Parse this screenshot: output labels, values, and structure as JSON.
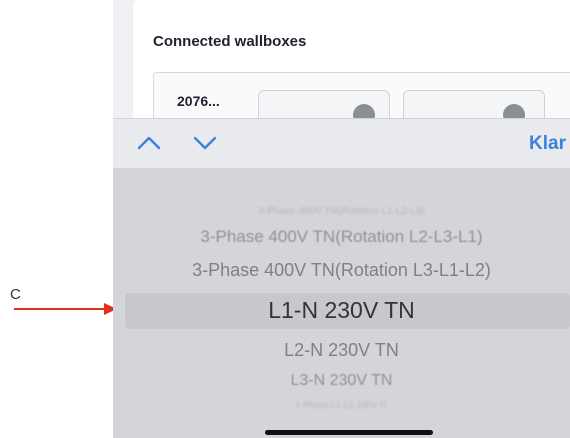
{
  "annotation": {
    "label": "C",
    "arrow_color": "#e0301e"
  },
  "page": {
    "section_title": "Connected wallboxes",
    "wallbox_label": "2076..."
  },
  "toolbar": {
    "prev_icon": "chevron-up-icon",
    "next_icon": "chevron-down-icon",
    "done_label": "Klar",
    "accent_color": "#3b82e0"
  },
  "picker": {
    "options": [
      "3-Phase 400V TN(Rotation L1-L2-L3)",
      "3-Phase 400V TN(Rotation L2-L3-L1)",
      "3-Phase 400V TN(Rotation L3-L1-L2)",
      "L1-N 230V TN",
      "L2-N 230V TN",
      "L3-N 230V TN",
      "1-Phase L1-L2 230V IT"
    ],
    "selected": "L1-N 230V TN"
  }
}
